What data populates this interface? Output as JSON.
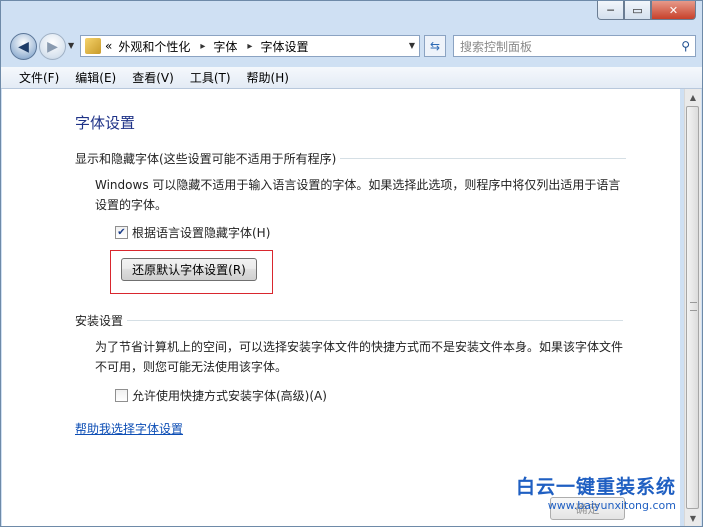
{
  "window": {
    "caption": {
      "minimize": "─",
      "maximize": "▭",
      "close": "✕"
    }
  },
  "nav": {
    "back_icon": "◀",
    "forward_icon": "▶",
    "history_icon": "▼",
    "address": {
      "overflow": "«",
      "segments": [
        "外观和个性化",
        "字体",
        "字体设置"
      ],
      "separator": "▸",
      "dropdown": "▼"
    },
    "refresh_icon": "⇆",
    "search": {
      "placeholder": "搜索控制面板",
      "icon": "⚲"
    }
  },
  "menu": [
    "文件(F)",
    "编辑(E)",
    "查看(V)",
    "工具(T)",
    "帮助(H)"
  ],
  "content": {
    "title": "字体设置",
    "section1": {
      "heading": "显示和隐藏字体(这些设置可能不适用于所有程序)",
      "description": "Windows 可以隐藏不适用于输入语言设置的字体。如果选择此选项，则程序中将仅列出适用于语言设置的字体。",
      "checkbox_label": "根据语言设置隐藏字体(H)",
      "checkbox_checked": "✔",
      "button_label": "还原默认字体设置(R)"
    },
    "section2": {
      "heading": "安装设置",
      "description": "为了节省计算机上的空间，可以选择安装字体文件的快捷方式而不是安装文件本身。如果该字体文件不可用，则您可能无法使用该字体。",
      "checkbox_label": "允许使用快捷方式安装字体(高级)(A)",
      "checkbox_checked": ""
    },
    "help_link": "帮助我选择字体设置",
    "ok_button": "确定"
  },
  "scrollbar": {
    "up": "▲",
    "down": "▼"
  },
  "watermark": {
    "main": "白云一键重装系统",
    "url": "www.baiyunxitong.com"
  }
}
